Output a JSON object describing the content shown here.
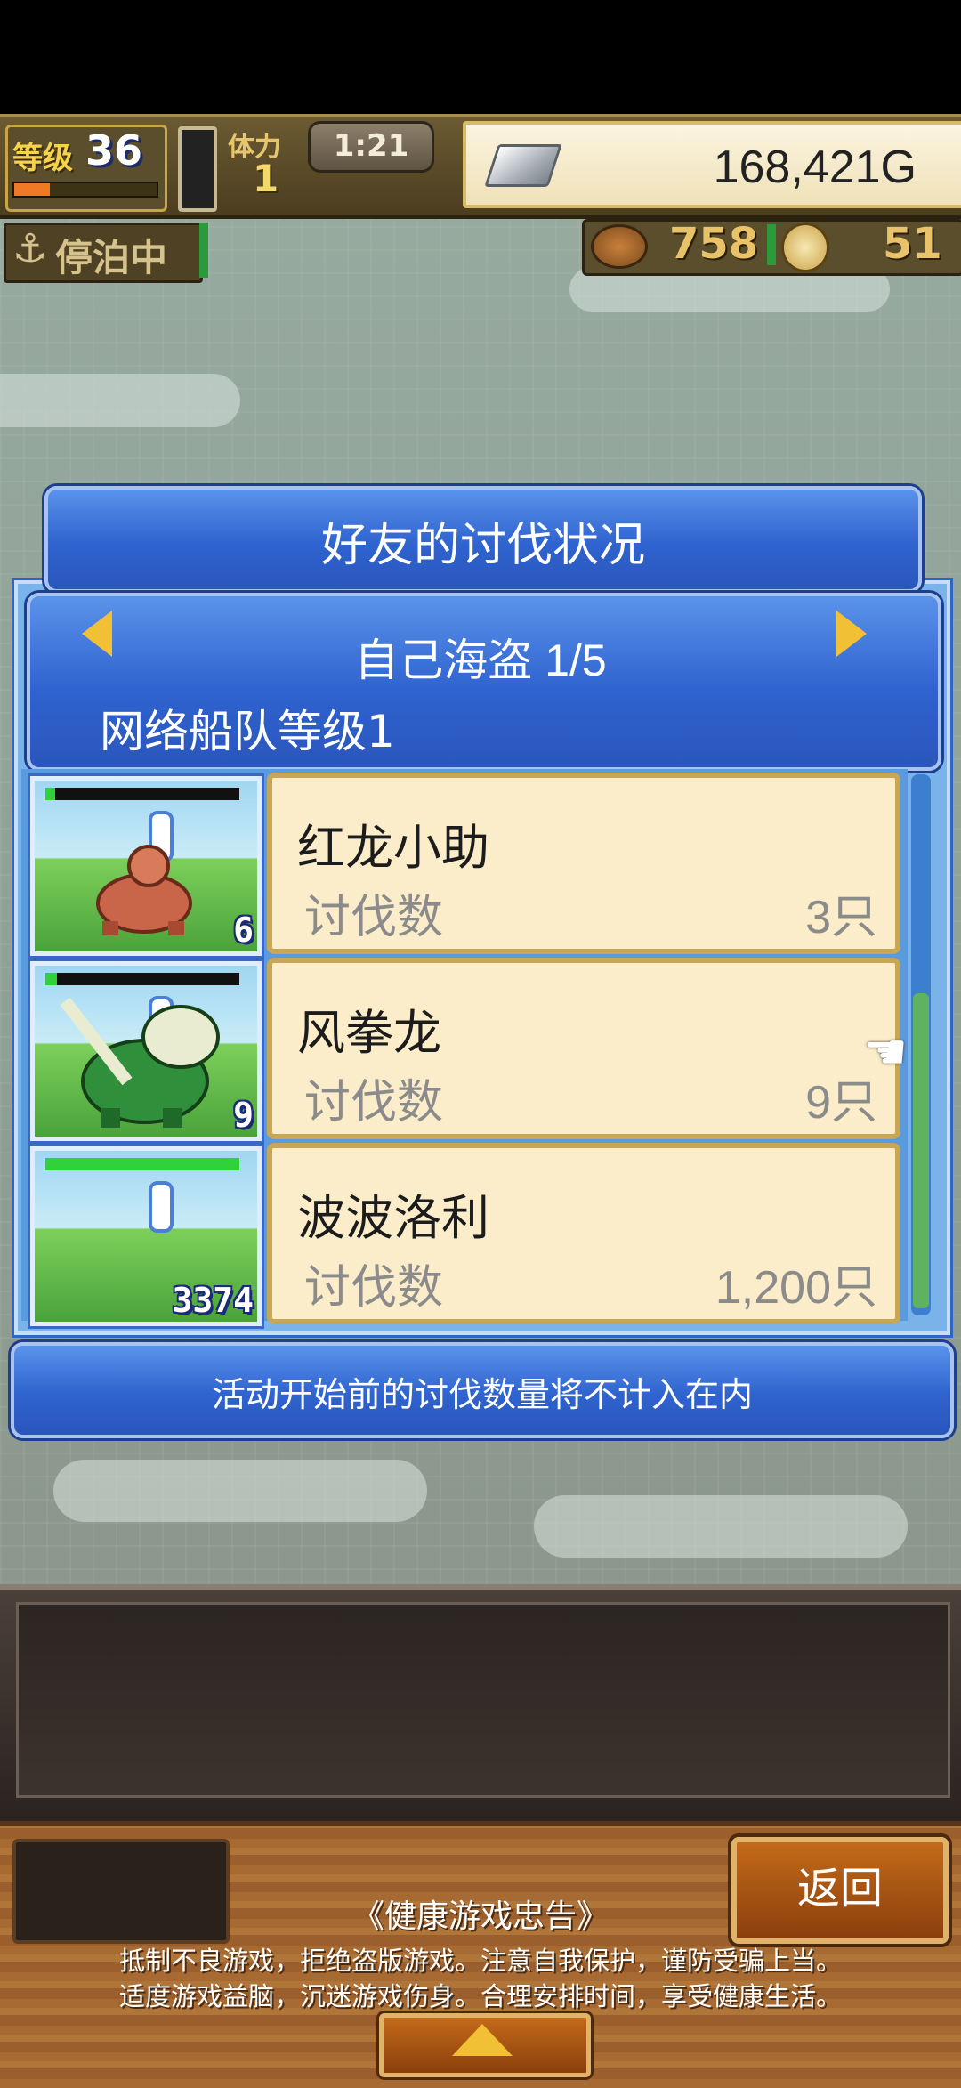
{
  "hud": {
    "level_label": "等级",
    "level_value": "36",
    "exp_progress": 0.25,
    "stamina_label": "体力",
    "stamina_value": "1",
    "timer": "1:21",
    "gold": "168,421G",
    "status_label": "停泊中",
    "food": "758",
    "coins": "51"
  },
  "dialog": {
    "title": "好友的讨伐状况",
    "pirate_title": "自己海盗 1/5",
    "fleet_level": "网络船队等级1",
    "rows": [
      {
        "name": "红龙小助",
        "count_label": "讨伐数",
        "count": "3只",
        "level_badge": "6",
        "hp": 0.05
      },
      {
        "name": "风拳龙",
        "count_label": "讨伐数",
        "count": "9只",
        "level_badge": "9",
        "hp": 0.06
      },
      {
        "name": "波波洛利",
        "count_label": "讨伐数",
        "count": "1,200只",
        "level_badge": "3374",
        "hp": 1.0
      }
    ],
    "notice": "活动开始前的讨伐数量将不计入在内"
  },
  "bottom": {
    "back_label": "返回",
    "health_title": "《健康游戏忠告》",
    "health_line1": "抵制不良游戏，拒绝盗版游戏。注意自我保护，谨防受骗上当。",
    "health_line2": "适度游戏益脑，沉迷游戏伤身。合理安排时间，享受健康生活。"
  },
  "colors": {
    "accent_blue": "#2f63cf",
    "card_bg": "#fbecca",
    "gold_text": "#f7d34b",
    "back_button": "#c46a1a"
  },
  "icons": [
    "anchor-icon",
    "silver-bar-icon",
    "food-icon",
    "coin-icon",
    "arrow-left-icon",
    "arrow-right-icon",
    "pointer-hand-icon",
    "expand-arrow-icon"
  ]
}
